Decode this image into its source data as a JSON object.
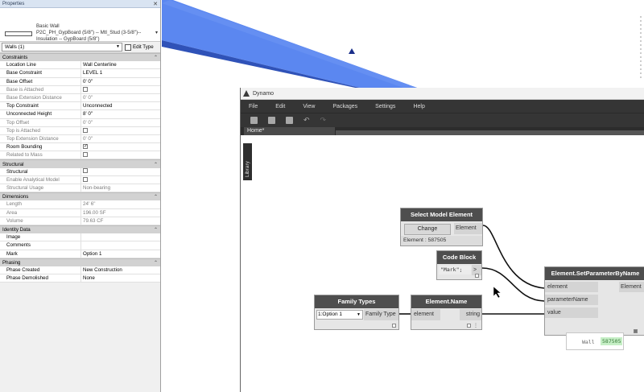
{
  "properties": {
    "title": "Properties",
    "type_family": "Basic Wall",
    "type_name_line1": "P2C_PH_GypBoard (5/8\") -- Mtl_Stud (3-5/8\")--",
    "type_name_line2": "Insulation -- GypBoard (5/8\")",
    "instance_filter": "Walls (1)",
    "edit_type_label": "Edit Type",
    "groups": [
      {
        "name": "Constraints",
        "rows": [
          {
            "k": "Location Line",
            "v": "Wall Centerline"
          },
          {
            "k": "Base Constraint",
            "v": "LEVEL 1"
          },
          {
            "k": "Base Offset",
            "v": "0'  0\""
          },
          {
            "k": "Base is Attached",
            "v": "",
            "cb": false,
            "dim": true
          },
          {
            "k": "Base Extension Distance",
            "v": "0'  0\"",
            "dim": true
          },
          {
            "k": "Top Constraint",
            "v": "Unconnected"
          },
          {
            "k": "Unconnected Height",
            "v": "8'  0\""
          },
          {
            "k": "Top Offset",
            "v": "0'  0\"",
            "dim": true
          },
          {
            "k": "Top is Attached",
            "v": "",
            "cb": false,
            "dim": true
          },
          {
            "k": "Top Extension Distance",
            "v": "0'  0\"",
            "dim": true
          },
          {
            "k": "Room Bounding",
            "v": "",
            "cb": true
          },
          {
            "k": "Related to Mass",
            "v": "",
            "cb": false,
            "dim": true
          }
        ]
      },
      {
        "name": "Structural",
        "rows": [
          {
            "k": "Structural",
            "v": "",
            "cb": false
          },
          {
            "k": "Enable Analytical Model",
            "v": "",
            "cb": false,
            "dim": true
          },
          {
            "k": "Structural Usage",
            "v": "Non-bearing",
            "dim": true
          }
        ]
      },
      {
        "name": "Dimensions",
        "rows": [
          {
            "k": "Length",
            "v": "24'  6\"",
            "dim": true
          },
          {
            "k": "Area",
            "v": "196.00 SF",
            "dim": true
          },
          {
            "k": "Volume",
            "v": "79.63 CF",
            "dim": true
          }
        ]
      },
      {
        "name": "Identity Data",
        "rows": [
          {
            "k": "Image",
            "v": ""
          },
          {
            "k": "Comments",
            "v": ""
          },
          {
            "k": "Mark",
            "v": "Option 1"
          }
        ]
      },
      {
        "name": "Phasing",
        "rows": [
          {
            "k": "Phase Created",
            "v": "New Construction"
          },
          {
            "k": "Phase Demolished",
            "v": "None"
          }
        ]
      }
    ]
  },
  "dynamo": {
    "title": "Dynamo",
    "menu": [
      "File",
      "Edit",
      "View",
      "Packages",
      "Settings",
      "Help"
    ],
    "tab": "Home*",
    "library_label": "Library",
    "nodes": {
      "select_model_element": {
        "title": "Select Model Element",
        "button": "Change",
        "out_port": "Element",
        "footer": "Element : 587505"
      },
      "code_block": {
        "title": "Code Block",
        "code": "\"Mark\";",
        "out_port": ">"
      },
      "family_types": {
        "title": "Family Types",
        "selected": "1:Option 1",
        "out_port": "Family Type"
      },
      "element_name": {
        "title": "Element.Name",
        "in_port": "element",
        "out_port": "string"
      },
      "set_parameter": {
        "title": "Element.SetParameterByName",
        "in_ports": [
          "element",
          "parameterName",
          "value"
        ],
        "out_port": "Element"
      }
    },
    "preview": {
      "label": "Wall",
      "value": "587505"
    }
  },
  "colors": {
    "wall_blue": "#5b87f0",
    "node_header": "#4e4e4e",
    "dynamo_dark": "#353535"
  }
}
